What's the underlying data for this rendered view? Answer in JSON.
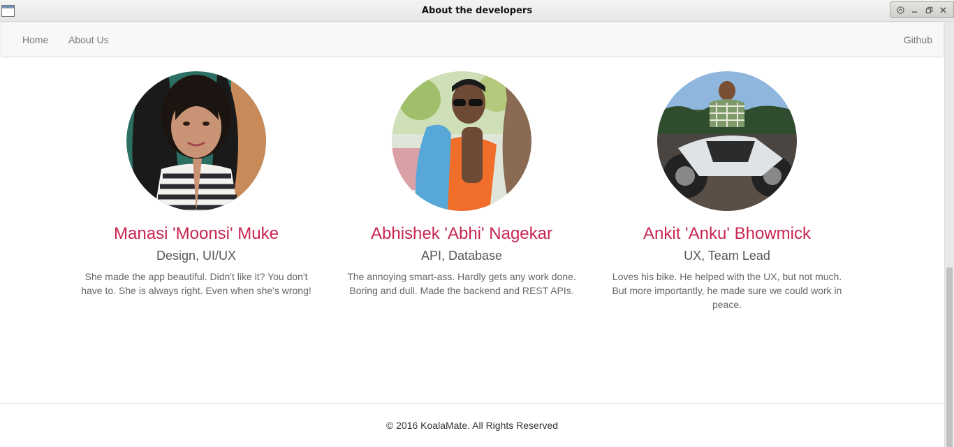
{
  "window": {
    "title": "About the developers"
  },
  "nav": {
    "home": "Home",
    "about": "About Us",
    "github": "Github"
  },
  "members": [
    {
      "name": "Manasi 'Moonsi' Muke",
      "role": "Design, UI/UX",
      "bio": "She made the app beautiful. Didn't like it? You don't have to. She is always right. Even when she's wrong!"
    },
    {
      "name": "Abhishek 'Abhi' Nagekar",
      "role": "API, Database",
      "bio": "The annoying smart-ass. Hardly gets any work done. Boring and dull. Made the backend and REST APIs."
    },
    {
      "name": "Ankit 'Anku' Bhowmick",
      "role": "UX, Team Lead",
      "bio": "Loves his bike. He helped with the UX, but not much. But more importantly, he made sure we could work in peace."
    }
  ],
  "footer": {
    "copyright": "© 2016 KoalaMate. All Rights Reserved"
  },
  "colors": {
    "accent": "#c9254f",
    "nav_text": "#777777",
    "nav_bg": "#f8f8f8"
  }
}
